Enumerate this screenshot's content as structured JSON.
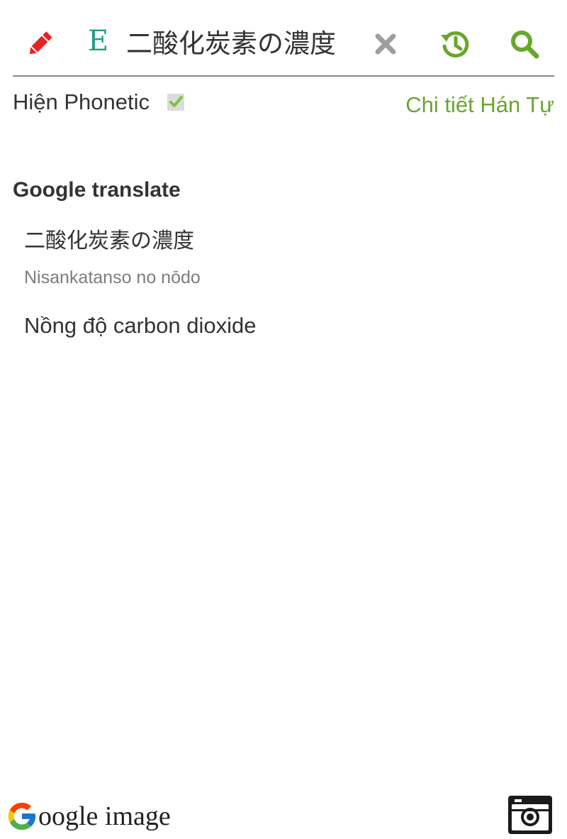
{
  "search": {
    "language_indicator": "E",
    "query": "二酸化炭素の濃度"
  },
  "options": {
    "phonetic_label": "Hiện Phonetic",
    "phonetic_checked": true,
    "kanji_detail_link": "Chi tiết Hán Tự"
  },
  "google_translate": {
    "title": "Google translate",
    "source": "二酸化炭素の濃度",
    "phonetic": "Nisankatanso no nōdo",
    "translation": "Nồng độ carbon dioxide"
  },
  "footer": {
    "google_image_label": "oogle image"
  },
  "colors": {
    "accent_green": "#6aa62f",
    "pencil_red": "#e8231f",
    "language_teal": "#1f9d86",
    "clear_gray": "#9e9e9e"
  },
  "icons": [
    "pencil-icon",
    "close-icon",
    "history-icon",
    "search-icon",
    "checkmark-icon",
    "google-g-icon",
    "camera-icon"
  ]
}
